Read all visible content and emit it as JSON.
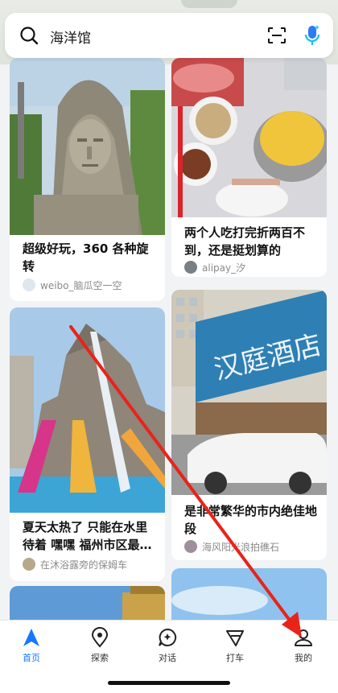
{
  "search": {
    "query": "海洋馆",
    "icons": [
      "search-icon",
      "scan-icon",
      "voice-mic-icon"
    ]
  },
  "feed": {
    "left": [
      {
        "title": "超级好玩，360 各种旋转",
        "author": "weibo_脑瓜空一空"
      },
      {
        "title": "夏天太热了 只能在水里待着 嘿嘿 福州市区最…",
        "author": "在沐浴露旁的保姆车"
      }
    ],
    "right": [
      {
        "title": "两个人吃打完折两百不到，还是挺划算的",
        "author": "alipay_汐"
      },
      {
        "title": "是非常繁华的市内绝佳地段",
        "author": "海风阳光浪拍礁石",
        "sign_text": "汉庭酒店"
      }
    ]
  },
  "tabbar": {
    "items": [
      {
        "label": "首页",
        "icon": "home-arrow-icon",
        "active": true
      },
      {
        "label": "探索",
        "icon": "location-pin-icon"
      },
      {
        "label": "对话",
        "icon": "chat-bubble-icon"
      },
      {
        "label": "打车",
        "icon": "taxi-flag-icon"
      },
      {
        "label": "我的",
        "icon": "profile-icon"
      }
    ]
  },
  "colors": {
    "accent": "#1677ff",
    "annotation": "#e8231a"
  }
}
